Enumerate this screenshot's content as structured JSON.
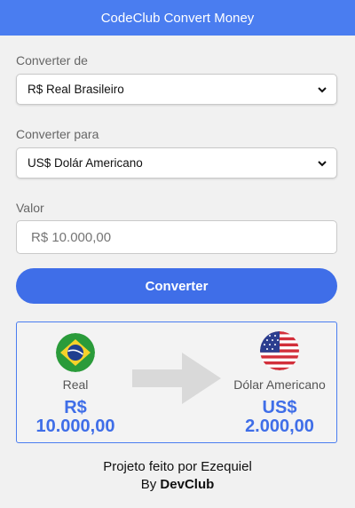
{
  "header": {
    "title": "CodeClub Convert Money"
  },
  "form": {
    "from_label": "Converter de",
    "from_selected": "R$ Real Brasileiro",
    "to_label": "Converter para",
    "to_selected": "US$ Dolár Americano",
    "value_label": "Valor",
    "value_placeholder": "R$ 10.000,00",
    "convert_button": "Converter"
  },
  "result": {
    "from_currency_name": "Real",
    "from_value_symbol": "R$",
    "from_value_amount": "10.000,00",
    "from_flag": "brazil-flag-icon",
    "to_currency_name": "Dólar Americano",
    "to_value_symbol": "US$",
    "to_value_amount": "2.000,00",
    "to_flag": "usa-flag-icon",
    "arrow_icon": "arrow-right-icon"
  },
  "footer": {
    "line1": "Projeto feito por Ezequiel",
    "line2_prefix": "By ",
    "line2_brand": "DevClub"
  },
  "colors": {
    "primary": "#4a7df0",
    "button": "#3f6ee8",
    "background": "#f1f1f1",
    "arrow": "#d9d9d9"
  }
}
